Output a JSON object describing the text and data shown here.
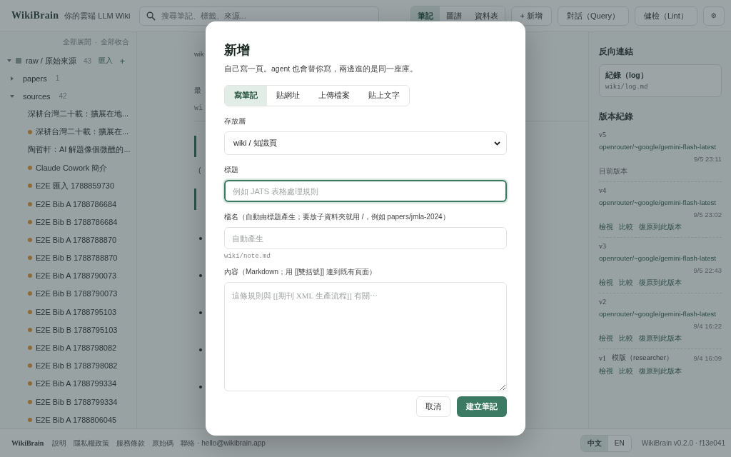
{
  "topbar": {
    "logo": "WikiBrain",
    "tagline": "你的雲端 LLM Wiki",
    "search": {
      "placeholder": "搜尋筆記、標籤、來源..."
    },
    "views": [
      {
        "label": "筆記",
        "selected": true
      },
      {
        "label": "圖譜",
        "selected": false
      },
      {
        "label": "資料表",
        "selected": false
      }
    ],
    "buttons": [
      "+ 新增",
      "對話（Query）",
      "健檢（Lint）"
    ],
    "settings": "⚙"
  },
  "sidebar": {
    "expand_all": "全部展開",
    "separator": "·",
    "collapse_all": "全部收合",
    "tree": [
      {
        "label": "raw / 原始來源",
        "count": "43",
        "import": "匯入",
        "add": "+",
        "expanded": true,
        "children": [
          {
            "label": "papers",
            "count": "1",
            "expanded": false
          },
          {
            "label": "sources",
            "count": "42",
            "expanded": true,
            "children": [
              {
                "label": "深耕台灣二十載：擴展在地..."
              },
              {
                "label": "深耕台灣二十載：擴展在...",
                "color": "#8c6b3b"
              },
              {
                "label": "陶哲軒：AI 解題像個微醺的..."
              },
              {
                "label": "Claude Cowork 簡介",
                "color": "#8c6b3b"
              },
              {
                "label": "E2E 匯入 1788859730",
                "color": "#8c6b3b"
              },
              {
                "label": "E2E Bib A 1788786684",
                "color": "#8c6b3b"
              },
              {
                "label": "E2E Bib B 1788786684",
                "color": "#8c6b3b"
              },
              {
                "label": "E2E Bib A 1788788870",
                "color": "#8c6b3b"
              },
              {
                "label": "E2E Bib B 1788788870",
                "color": "#8c6b3b"
              },
              {
                "label": "E2E Bib A 1788790073",
                "color": "#8c6b3b"
              },
              {
                "label": "E2E Bib B 1788790073",
                "color": "#8c6b3b"
              },
              {
                "label": "E2E Bib A 1788795103",
                "color": "#8c6b3b"
              },
              {
                "label": "E2E Bib B 1788795103",
                "color": "#8c6b3b"
              },
              {
                "label": "E2E Bib A 1788798082",
                "color": "#8c6b3b"
              },
              {
                "label": "E2E Bib B 1788798082",
                "color": "#8c6b3b"
              },
              {
                "label": "E2E Bib A 1788799334",
                "color": "#8c6b3b"
              },
              {
                "label": "E2E Bib B 1788799334",
                "color": "#8c6b3b"
              },
              {
                "label": "E2E Bib A 1788806045",
                "color": "#8c6b3b"
              }
            ]
          }
        ]
      }
    ]
  },
  "main": {
    "path": "wik",
    "meta": "最",
    "file": "wi",
    "note": "("
  },
  "right_panel": {
    "backlinks_title": "反向連結",
    "backlinks": [
      {
        "title": "紀錄（log）",
        "path": "wiki/log.md"
      }
    ],
    "versions_title": "版本紀錄",
    "versions": [
      {
        "kind": "current",
        "version": "v5",
        "author": "openrouter/~google/gemini-flash-latest",
        "time": "9/5 23:11",
        "status": "目前版本"
      },
      {
        "kind": "past",
        "version": "v4",
        "author": "openrouter/~google/gemini-flash-latest",
        "time": "9/5 23:02",
        "actions": [
          "檢視",
          "比較",
          "復原到此版本"
        ]
      },
      {
        "kind": "past",
        "version": "v3",
        "author": "openrouter/~google/gemini-flash-latest",
        "time": "9/5 22:43",
        "actions": [
          "檢視",
          "比較",
          "復原到此版本"
        ]
      },
      {
        "kind": "past",
        "version": "v2",
        "author": "openrouter/~google/gemini-flash-latest",
        "time": "9/4 16:22",
        "actions": [
          "檢視",
          "比較",
          "復原到此版本"
        ]
      },
      {
        "kind": "compact",
        "version": "v1",
        "author": "模版（researcher）",
        "time": "9/4 16:09",
        "actions": [
          "檢視",
          "比較",
          "復原到此版本"
        ]
      }
    ]
  },
  "footer": {
    "logo": "WikiBrain",
    "links": [
      "說明",
      "隱私權政策",
      "服務條款",
      "原始碼"
    ],
    "contact": "聯絡 · hello@wikibrain.app",
    "languages": [
      {
        "label": "中文",
        "selected": true
      },
      {
        "label": "EN",
        "selected": false
      }
    ],
    "version": "WikiBrain v0.2.0 · f13e041"
  },
  "dialog": {
    "title": "新增",
    "subtitle": "自己寫一頁。agent 也會替你寫，兩邊進的是同一座庫。",
    "tabs": [
      {
        "label": "寫筆記",
        "selected": true
      },
      {
        "label": "貼網址",
        "selected": false
      },
      {
        "label": "上傳檔案",
        "selected": false
      },
      {
        "label": "貼上文字",
        "selected": false
      }
    ],
    "layer": {
      "label": "存放層",
      "value": "wiki / 知識頁"
    },
    "title_field": {
      "label": "標題",
      "placeholder": "例如 JATS 表格處理規則",
      "focused": true
    },
    "filename": {
      "label": "檔名（自動由標題產生；要放子資料夾就用 /，例如 papers/jmla-2024）",
      "placeholder": "自動產生",
      "hint": "wiki/note.md"
    },
    "content": {
      "label": "內容（Markdown；用 [[雙括號]] 連到既有頁面）",
      "placeholder": "這條規則與 [[期刊 XML 生產流程]] 有關⋯"
    },
    "cancel": "取消",
    "submit": "建立筆記"
  }
}
